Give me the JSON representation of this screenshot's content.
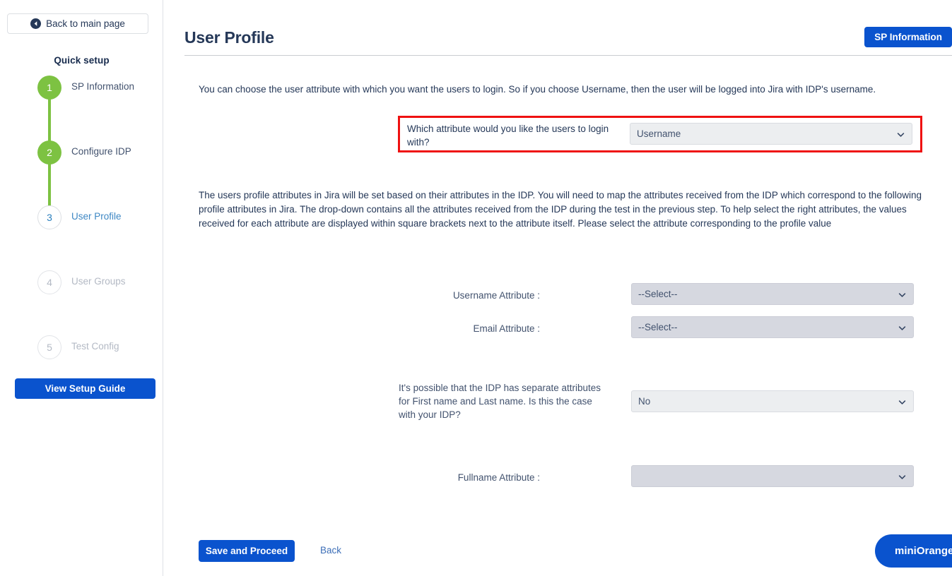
{
  "sidebar": {
    "back_button": "Back to main page",
    "back_icon": "arrow-left-circle-icon",
    "quick_setup_title": "Quick setup",
    "steps": [
      {
        "number": "1",
        "label": "SP Information",
        "state": "done"
      },
      {
        "number": "2",
        "label": "Configure IDP",
        "state": "done"
      },
      {
        "number": "3",
        "label": "User Profile",
        "state": "current"
      },
      {
        "number": "4",
        "label": "User Groups",
        "state": "todo"
      },
      {
        "number": "5",
        "label": "Test Config",
        "state": "todo"
      }
    ],
    "setup_guide_button": "View Setup Guide"
  },
  "header": {
    "title": "User Profile",
    "sp_information_button": "SP Information"
  },
  "main": {
    "intro_text": "You can choose the user attribute with which you want the users to login. So if you choose Username, then the user will be logged into Jira with IDP's username.",
    "highlighted": {
      "label": "Which attribute would you like the users to login with?",
      "value": "Username",
      "chevron_icon": "chevron-down-icon"
    },
    "body_text": "The users profile attributes in Jira will be set based on their attributes in the IDP. You will need to map the attributes received from the IDP which correspond to the following profile attributes in Jira. The drop-down contains all the attributes received from the IDP during the test in the previous step. To help select the right attributes, the values received for each attribute are displayed within square brackets next to the attribute itself. Please select the attribute corresponding to the profile value",
    "fields": {
      "username_attribute": {
        "label": "Username Attribute :",
        "value": "--Select--"
      },
      "email_attribute": {
        "label": "Email Attribute :",
        "value": "--Select--"
      },
      "separate_names": {
        "label": "It's possible that the IDP has separate attributes for First name and Last name. Is this the case with your IDP?",
        "value": "No"
      },
      "fullname_attribute": {
        "label": "Fullname Attribute :",
        "value": ""
      }
    },
    "save_button": "Save and Proceed",
    "back_link": "Back",
    "support_button": "miniOrange Support"
  }
}
